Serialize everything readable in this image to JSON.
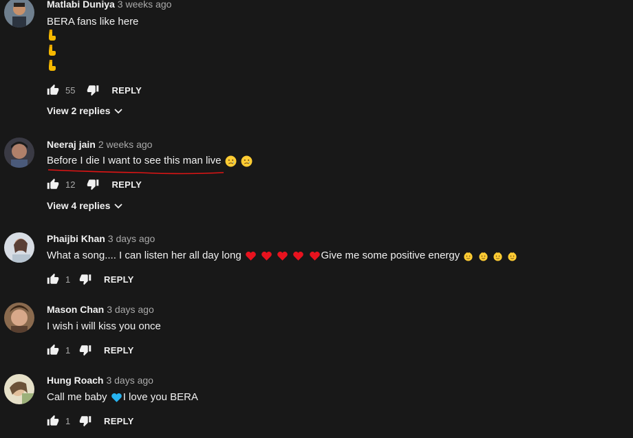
{
  "comments": [
    {
      "author": "Matlabi Duniya",
      "time": "3 weeks ago",
      "lines": [
        "BERA fans like here"
      ],
      "extra_emoji": [
        "point-down-emoji",
        "point-down-emoji",
        "point-down-emoji"
      ],
      "likes": "55",
      "reply_label": "REPLY",
      "view_replies": "View 2 replies"
    },
    {
      "author": "Neeraj jain",
      "time": "2 weeks ago",
      "text": "Before I die I want to see this man live",
      "emoji": [
        "sad-tear-emoji",
        "sad-tear-emoji"
      ],
      "likes": "12",
      "reply_label": "REPLY",
      "view_replies": "View 4 replies"
    },
    {
      "author": "Phaijbi Khan",
      "time": "3 days ago",
      "text_before": "What a song.... I can listen her all day long",
      "text_after": "Give me some positive energy",
      "hearts": [
        "red-heart-emoji",
        "red-heart-emoji",
        "red-heart-emoji",
        "red-heart-emoji",
        "red-heart-emoji"
      ],
      "smileys": [
        "smiley-emoji",
        "smiley-emoji",
        "smiley-emoji",
        "smiley-emoji"
      ],
      "likes": "1",
      "reply_label": "REPLY"
    },
    {
      "author": "Mason Chan",
      "time": "3 days ago",
      "text": "I wish i will kiss you once",
      "likes": "1",
      "reply_label": "REPLY"
    },
    {
      "author": "Hung Roach",
      "time": "3 days ago",
      "text_before": "Call me baby",
      "text_after": "I love you BERA",
      "emoji": [
        "blue-heart-emoji"
      ],
      "likes": "1",
      "reply_label": "REPLY"
    }
  ],
  "colors": {
    "background": "#181818",
    "text": "#f1f1f1",
    "secondary": "#aaaaaa",
    "annotation": "#e01515"
  }
}
